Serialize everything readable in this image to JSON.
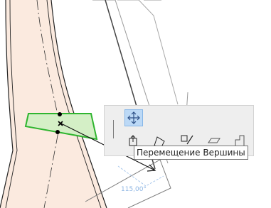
{
  "tooltip": {
    "text": "Перемещение Вершины"
  },
  "dimension": {
    "text": "115,00°"
  },
  "pet_palette": {
    "buttons": [
      {
        "icon": "move-node-icon",
        "active": true
      },
      {
        "icon": "insert-node-icon",
        "active": false
      },
      {
        "icon": "rotate-segment-icon",
        "active": false
      },
      {
        "icon": "offset-edge-icon",
        "active": false
      },
      {
        "icon": "offset-all-edges-icon",
        "active": false
      },
      {
        "icon": "curve-edge-icon",
        "active": false
      }
    ]
  },
  "colors": {
    "wall_fill": "#fbeadf",
    "selected_segment_fill": "#d4efc6",
    "selected_segment_stroke": "#2fb52f",
    "palette_bg": "#eeeeee",
    "active_button": "#bcd9f6",
    "dimension_text": "#8fb6e3"
  }
}
